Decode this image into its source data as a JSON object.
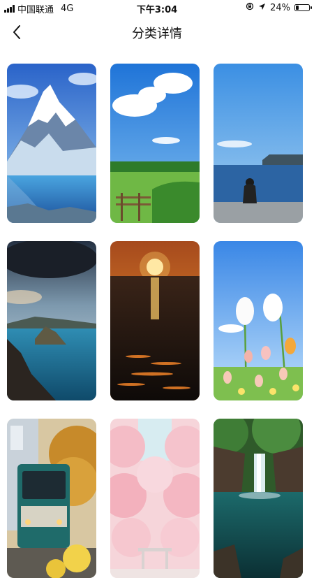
{
  "status_bar": {
    "carrier": "中国联通",
    "network": "4G",
    "time": "下午3:04",
    "battery_percent": "24%",
    "battery_level": 0.24,
    "icons": [
      "signal-icon",
      "lock-rotation-icon",
      "location-arrow-icon",
      "battery-icon"
    ]
  },
  "nav": {
    "title": "分类详情",
    "back_icon": "chevron-left-icon"
  },
  "wallpapers": [
    {
      "subject": "snowy-mountain-lake",
      "name": "wallpaper-mountain"
    },
    {
      "subject": "green-meadow-blue-sky",
      "name": "wallpaper-meadow"
    },
    {
      "subject": "person-by-sea",
      "name": "wallpaper-seaside"
    },
    {
      "subject": "volcanic-crater-lake",
      "name": "wallpaper-crater-lake"
    },
    {
      "subject": "sunset-over-sea",
      "name": "wallpaper-sunset"
    },
    {
      "subject": "white-tulips",
      "name": "wallpaper-tulips"
    },
    {
      "subject": "tram-in-street",
      "name": "wallpaper-tram"
    },
    {
      "subject": "pink-cherry-blossoms",
      "name": "wallpaper-cherry-blossom"
    },
    {
      "subject": "forest-waterfall",
      "name": "wallpaper-waterfall"
    }
  ],
  "colors": {
    "background": "#ffffff",
    "text": "#111111"
  }
}
